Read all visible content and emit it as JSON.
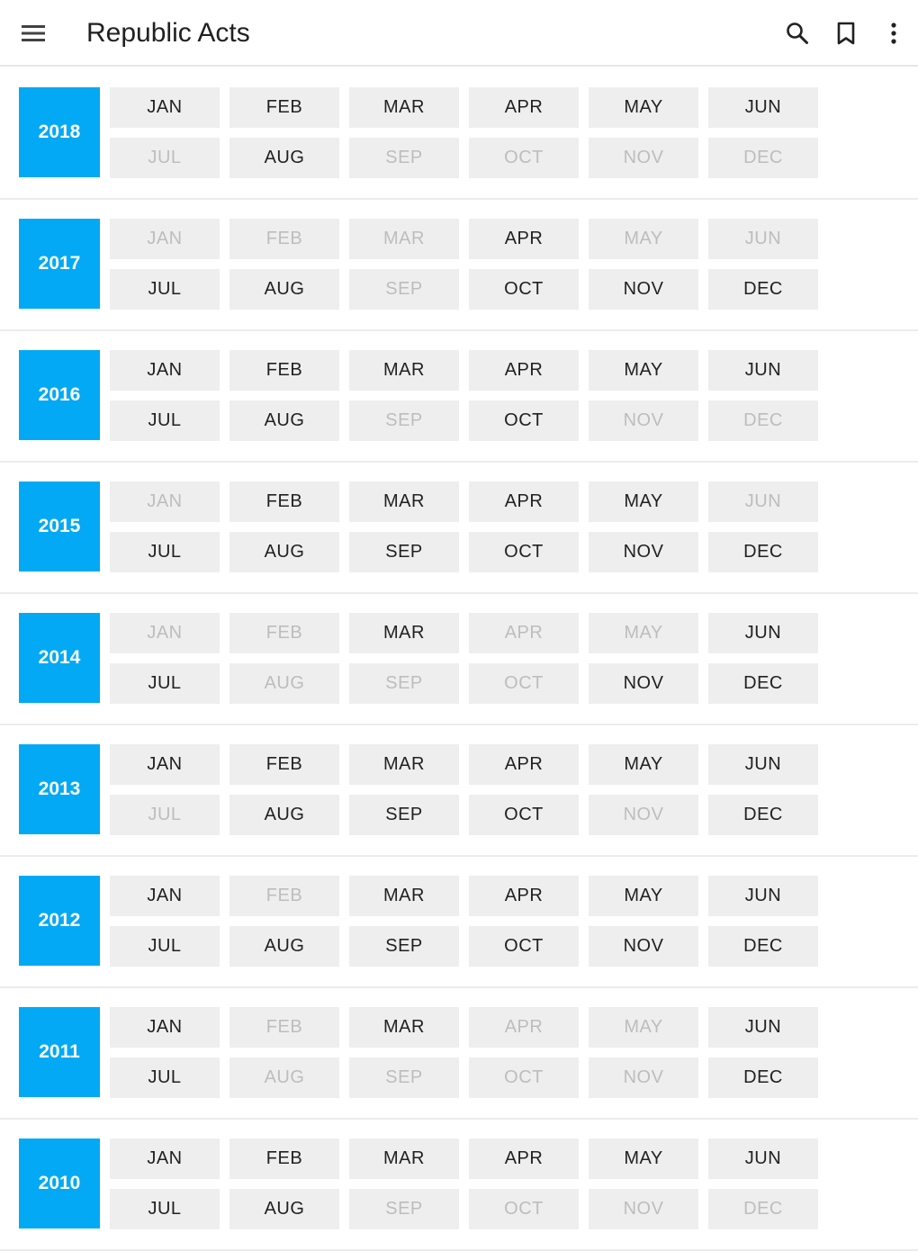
{
  "appbar": {
    "title": "Republic Acts",
    "icons": {
      "menu": "menu-icon",
      "search": "search-icon",
      "bookmark": "bookmark-icon",
      "more": "more-vert-icon"
    }
  },
  "colors": {
    "accent": "#03a9f4",
    "month_bg": "#eeeeee",
    "month_text": "#212121",
    "month_disabled_text": "#bdbdbd"
  },
  "years": [
    {
      "year": "2018",
      "months": [
        {
          "label": "JAN",
          "enabled": true
        },
        {
          "label": "FEB",
          "enabled": true
        },
        {
          "label": "MAR",
          "enabled": true
        },
        {
          "label": "APR",
          "enabled": true
        },
        {
          "label": "MAY",
          "enabled": true
        },
        {
          "label": "JUN",
          "enabled": true
        },
        {
          "label": "JUL",
          "enabled": false
        },
        {
          "label": "AUG",
          "enabled": true
        },
        {
          "label": "SEP",
          "enabled": false
        },
        {
          "label": "OCT",
          "enabled": false
        },
        {
          "label": "NOV",
          "enabled": false
        },
        {
          "label": "DEC",
          "enabled": false
        }
      ]
    },
    {
      "year": "2017",
      "months": [
        {
          "label": "JAN",
          "enabled": false
        },
        {
          "label": "FEB",
          "enabled": false
        },
        {
          "label": "MAR",
          "enabled": false
        },
        {
          "label": "APR",
          "enabled": true
        },
        {
          "label": "MAY",
          "enabled": false
        },
        {
          "label": "JUN",
          "enabled": false
        },
        {
          "label": "JUL",
          "enabled": true
        },
        {
          "label": "AUG",
          "enabled": true
        },
        {
          "label": "SEP",
          "enabled": false
        },
        {
          "label": "OCT",
          "enabled": true
        },
        {
          "label": "NOV",
          "enabled": true
        },
        {
          "label": "DEC",
          "enabled": true
        }
      ]
    },
    {
      "year": "2016",
      "months": [
        {
          "label": "JAN",
          "enabled": true
        },
        {
          "label": "FEB",
          "enabled": true
        },
        {
          "label": "MAR",
          "enabled": true
        },
        {
          "label": "APR",
          "enabled": true
        },
        {
          "label": "MAY",
          "enabled": true
        },
        {
          "label": "JUN",
          "enabled": true
        },
        {
          "label": "JUL",
          "enabled": true
        },
        {
          "label": "AUG",
          "enabled": true
        },
        {
          "label": "SEP",
          "enabled": false
        },
        {
          "label": "OCT",
          "enabled": true
        },
        {
          "label": "NOV",
          "enabled": false
        },
        {
          "label": "DEC",
          "enabled": false
        }
      ]
    },
    {
      "year": "2015",
      "months": [
        {
          "label": "JAN",
          "enabled": false
        },
        {
          "label": "FEB",
          "enabled": true
        },
        {
          "label": "MAR",
          "enabled": true
        },
        {
          "label": "APR",
          "enabled": true
        },
        {
          "label": "MAY",
          "enabled": true
        },
        {
          "label": "JUN",
          "enabled": false
        },
        {
          "label": "JUL",
          "enabled": true
        },
        {
          "label": "AUG",
          "enabled": true
        },
        {
          "label": "SEP",
          "enabled": true
        },
        {
          "label": "OCT",
          "enabled": true
        },
        {
          "label": "NOV",
          "enabled": true
        },
        {
          "label": "DEC",
          "enabled": true
        }
      ]
    },
    {
      "year": "2014",
      "months": [
        {
          "label": "JAN",
          "enabled": false
        },
        {
          "label": "FEB",
          "enabled": false
        },
        {
          "label": "MAR",
          "enabled": true
        },
        {
          "label": "APR",
          "enabled": false
        },
        {
          "label": "MAY",
          "enabled": false
        },
        {
          "label": "JUN",
          "enabled": true
        },
        {
          "label": "JUL",
          "enabled": true
        },
        {
          "label": "AUG",
          "enabled": false
        },
        {
          "label": "SEP",
          "enabled": false
        },
        {
          "label": "OCT",
          "enabled": false
        },
        {
          "label": "NOV",
          "enabled": true
        },
        {
          "label": "DEC",
          "enabled": true
        }
      ]
    },
    {
      "year": "2013",
      "months": [
        {
          "label": "JAN",
          "enabled": true
        },
        {
          "label": "FEB",
          "enabled": true
        },
        {
          "label": "MAR",
          "enabled": true
        },
        {
          "label": "APR",
          "enabled": true
        },
        {
          "label": "MAY",
          "enabled": true
        },
        {
          "label": "JUN",
          "enabled": true
        },
        {
          "label": "JUL",
          "enabled": false
        },
        {
          "label": "AUG",
          "enabled": true
        },
        {
          "label": "SEP",
          "enabled": true
        },
        {
          "label": "OCT",
          "enabled": true
        },
        {
          "label": "NOV",
          "enabled": false
        },
        {
          "label": "DEC",
          "enabled": true
        }
      ]
    },
    {
      "year": "2012",
      "months": [
        {
          "label": "JAN",
          "enabled": true
        },
        {
          "label": "FEB",
          "enabled": false
        },
        {
          "label": "MAR",
          "enabled": true
        },
        {
          "label": "APR",
          "enabled": true
        },
        {
          "label": "MAY",
          "enabled": true
        },
        {
          "label": "JUN",
          "enabled": true
        },
        {
          "label": "JUL",
          "enabled": true
        },
        {
          "label": "AUG",
          "enabled": true
        },
        {
          "label": "SEP",
          "enabled": true
        },
        {
          "label": "OCT",
          "enabled": true
        },
        {
          "label": "NOV",
          "enabled": true
        },
        {
          "label": "DEC",
          "enabled": true
        }
      ]
    },
    {
      "year": "2011",
      "months": [
        {
          "label": "JAN",
          "enabled": true
        },
        {
          "label": "FEB",
          "enabled": false
        },
        {
          "label": "MAR",
          "enabled": true
        },
        {
          "label": "APR",
          "enabled": false
        },
        {
          "label": "MAY",
          "enabled": false
        },
        {
          "label": "JUN",
          "enabled": true
        },
        {
          "label": "JUL",
          "enabled": true
        },
        {
          "label": "AUG",
          "enabled": false
        },
        {
          "label": "SEP",
          "enabled": false
        },
        {
          "label": "OCT",
          "enabled": false
        },
        {
          "label": "NOV",
          "enabled": false
        },
        {
          "label": "DEC",
          "enabled": true
        }
      ]
    },
    {
      "year": "2010",
      "months": [
        {
          "label": "JAN",
          "enabled": true
        },
        {
          "label": "FEB",
          "enabled": true
        },
        {
          "label": "MAR",
          "enabled": true
        },
        {
          "label": "APR",
          "enabled": true
        },
        {
          "label": "MAY",
          "enabled": true
        },
        {
          "label": "JUN",
          "enabled": true
        },
        {
          "label": "JUL",
          "enabled": true
        },
        {
          "label": "AUG",
          "enabled": true
        },
        {
          "label": "SEP",
          "enabled": false
        },
        {
          "label": "OCT",
          "enabled": false
        },
        {
          "label": "NOV",
          "enabled": false
        },
        {
          "label": "DEC",
          "enabled": false
        }
      ]
    }
  ]
}
